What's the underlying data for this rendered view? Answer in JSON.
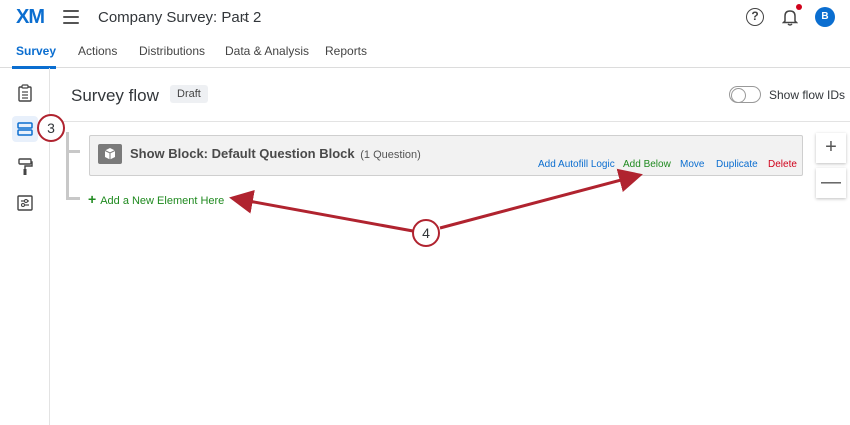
{
  "app": {
    "logo": "XM",
    "survey_title": "Company Survey: Part 2",
    "avatar_initial": "B"
  },
  "tabs": [
    "Survey",
    "Actions",
    "Distributions",
    "Data & Analysis",
    "Reports"
  ],
  "rail": {
    "items": [
      "clipboard-icon",
      "survey-flow-icon",
      "paint-roller-icon",
      "options-icon"
    ]
  },
  "header": {
    "title": "Survey flow",
    "status": "Draft",
    "toggle_label": "Show flow IDs"
  },
  "block": {
    "title": "Show Block: Default Question Block",
    "count": "(1 Question)",
    "actions": {
      "autofill": "Add Autofill Logic",
      "add_below": "Add Below",
      "move": "Move",
      "duplicate": "Duplicate",
      "delete": "Delete"
    }
  },
  "add_element": {
    "icon": "+",
    "label": "Add a New Element Here"
  },
  "zoom": {
    "in": "+",
    "out": "—"
  },
  "callouts": [
    "3",
    "4"
  ],
  "colors": {
    "brand": "#0b6ed0",
    "add_green": "#1f8a1f",
    "delete_red": "#d0021b",
    "callout_red": "#b0232f"
  }
}
